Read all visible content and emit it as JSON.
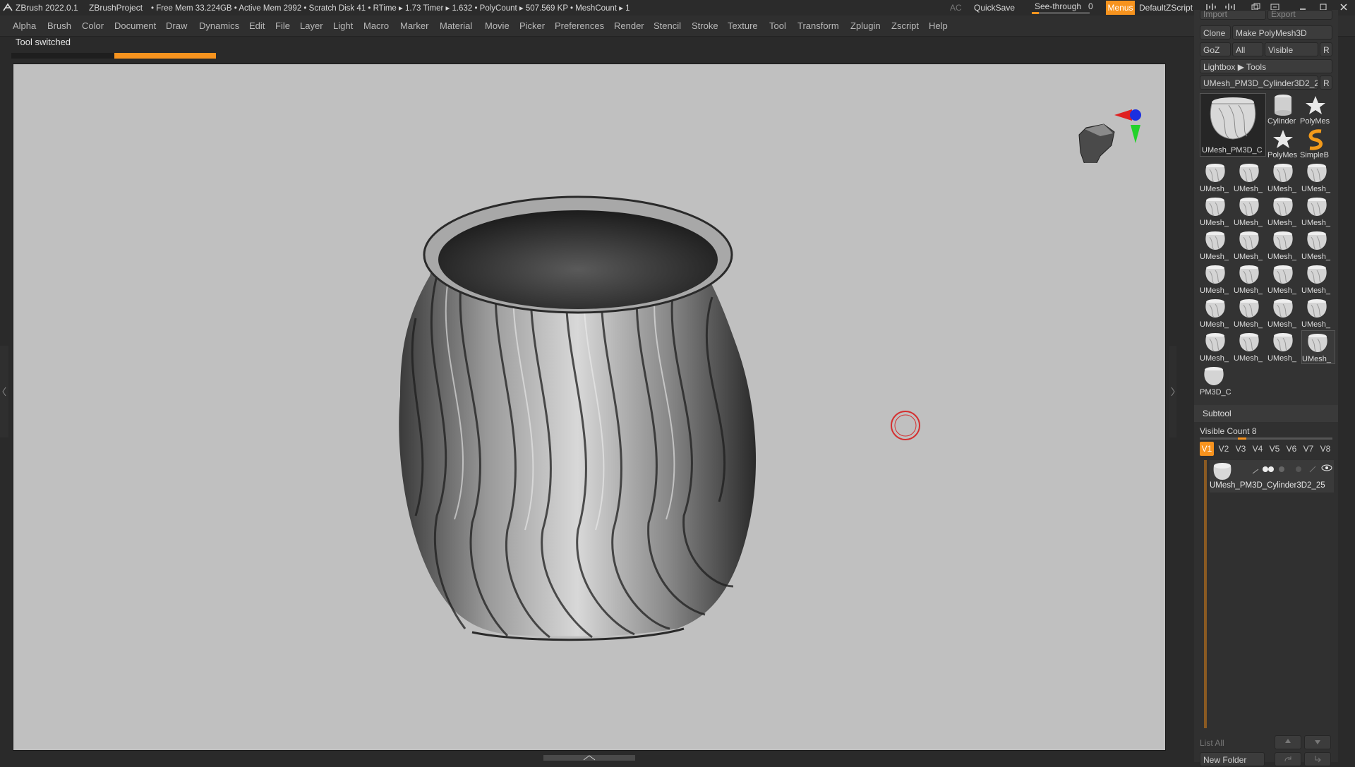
{
  "titlebar": {
    "app_name": "ZBrush 2022.0.1",
    "project": "ZBrushProject",
    "stats": "• Free Mem 33.224GB • Active Mem 2992 • Scratch Disk 41 •  RTime ▸ 1.73 Timer ▸ 1.632 • PolyCount ▸ 507.569 KP  • MeshCount ▸ 1",
    "ac": "AC",
    "quicksave": "QuickSave",
    "see_through_label": "See-through",
    "see_through_value": "0",
    "menus_label": "Menus",
    "script_name": "DefaultZScript"
  },
  "menu": [
    "Alpha",
    "Brush",
    "Color",
    "Document",
    "Draw",
    "Dynamics",
    "Edit",
    "File",
    "Layer",
    "Light",
    "Macro",
    "Marker",
    "Material",
    "Movie",
    "Picker",
    "Preferences",
    "Render",
    "Stencil",
    "Stroke",
    "Texture",
    "Tool",
    "Transform",
    "Zplugin",
    "Zscript",
    "Help"
  ],
  "notification": "Tool switched",
  "progress": 0.4,
  "tool_panel": {
    "top_left": "Import",
    "top_right": "Export",
    "clone": "Clone",
    "make_polymesh": "Make PolyMesh3D",
    "goz": "GoZ",
    "all": "All",
    "visible": "Visible",
    "r": "R",
    "lightbox_tools": "Lightbox ▶ Tools",
    "current_tool": "UMesh_PM3D_Cylinder3D2_2",
    "current_tool_thumb_label": "UMesh_PM3D_C",
    "quick_tools": [
      "Cylinder",
      "PolyMes",
      "PolyMes",
      "SimpleB"
    ],
    "grid_label": "UMesh_",
    "last_label": "PM3D_C"
  },
  "subtool": {
    "title": "Subtool",
    "visible_count": "Visible Count 8",
    "versions": [
      "V1",
      "V2",
      "V3",
      "V4",
      "V5",
      "V6",
      "V7",
      "V8"
    ],
    "item_name": "UMesh_PM3D_Cylinder3D2_25",
    "list_all": "List All",
    "new_folder": "New Folder"
  },
  "colors": {
    "accent": "#f7931e",
    "viewport_bg": "#c0c0c0",
    "panel_bg": "#333333"
  }
}
